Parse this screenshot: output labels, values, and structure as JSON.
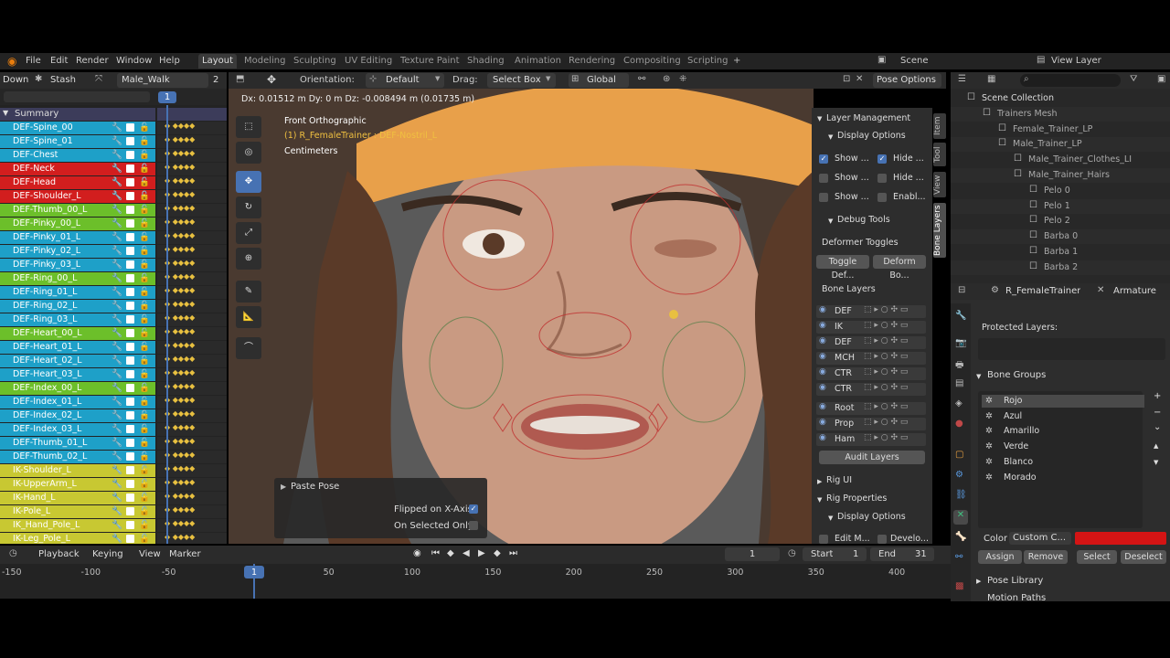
{
  "topbar": {
    "menus": [
      "File",
      "Edit",
      "Render",
      "Window",
      "Help"
    ],
    "workspaces": [
      "Layout",
      "Modeling",
      "Sculpting",
      "UV Editing",
      "Texture Paint",
      "Shading",
      "Animation",
      "Rendering",
      "Compositing",
      "Scripting"
    ],
    "add_tab": "+",
    "scene": "Scene",
    "view_layer": "View Layer"
  },
  "dopesheet": {
    "mode": "Down",
    "stash": "Stash",
    "action": "Male_Walk",
    "users": "2",
    "current_frame": "1",
    "summary": "Summary",
    "channels": [
      {
        "name": "DEF-Spine_00",
        "color": "#1ea0c8"
      },
      {
        "name": "DEF-Spine_01",
        "color": "#1ea0c8"
      },
      {
        "name": "DEF-Chest",
        "color": "#1ea0c8"
      },
      {
        "name": "DEF-Neck",
        "color": "#d21e1e"
      },
      {
        "name": "DEF-Head",
        "color": "#d21e1e"
      },
      {
        "name": "DEF-Shoulder_L",
        "color": "#d21e1e"
      },
      {
        "name": "DEF-Thumb_00_L",
        "color": "#6cbf2a"
      },
      {
        "name": "DEF-Pinky_00_L",
        "color": "#6cbf2a"
      },
      {
        "name": "DEF-Pinky_01_L",
        "color": "#1ea0c8"
      },
      {
        "name": "DEF-Pinky_02_L",
        "color": "#1ea0c8"
      },
      {
        "name": "DEF-Pinky_03_L",
        "color": "#1ea0c8"
      },
      {
        "name": "DEF-Ring_00_L",
        "color": "#6cbf2a"
      },
      {
        "name": "DEF-Ring_01_L",
        "color": "#1ea0c8"
      },
      {
        "name": "DEF-Ring_02_L",
        "color": "#1ea0c8"
      },
      {
        "name": "DEF-Ring_03_L",
        "color": "#1ea0c8"
      },
      {
        "name": "DEF-Heart_00_L",
        "color": "#6cbf2a"
      },
      {
        "name": "DEF-Heart_01_L",
        "color": "#1ea0c8"
      },
      {
        "name": "DEF-Heart_02_L",
        "color": "#1ea0c8"
      },
      {
        "name": "DEF-Heart_03_L",
        "color": "#1ea0c8"
      },
      {
        "name": "DEF-Index_00_L",
        "color": "#6cbf2a"
      },
      {
        "name": "DEF-Index_01_L",
        "color": "#1ea0c8"
      },
      {
        "name": "DEF-Index_02_L",
        "color": "#1ea0c8"
      },
      {
        "name": "DEF-Index_03_L",
        "color": "#1ea0c8"
      },
      {
        "name": "DEF-Thumb_01_L",
        "color": "#1ea0c8"
      },
      {
        "name": "DEF-Thumb_02_L",
        "color": "#1ea0c8"
      },
      {
        "name": "IK-Shoulder_L",
        "color": "#c8c832"
      },
      {
        "name": "IK-UpperArm_L",
        "color": "#c8c832"
      },
      {
        "name": "IK-Hand_L",
        "color": "#c8c832"
      },
      {
        "name": "IK-Pole_L",
        "color": "#c8c832"
      },
      {
        "name": "IK_Hand_Pole_L",
        "color": "#c8c832"
      },
      {
        "name": "IK-Leg_Pole_L",
        "color": "#c8c832"
      }
    ]
  },
  "viewport": {
    "orientation_label": "Orientation:",
    "orientation_value": "Default",
    "drag_label": "Drag:",
    "drag_value": "Select Box",
    "transform_space": "Global",
    "pose_options": "Pose Options",
    "status": "Dx: 0.01512 m   Dy: 0 m   Dz: -0.008494 m (0.01735 m)",
    "view_name": "Front Orthographic",
    "active_bone": "(1) R_FemaleTrainer : DEF-Nostril_L",
    "units": "Centimeters"
  },
  "npanel": {
    "tabs": [
      "Item",
      "Tool",
      "View",
      "Bone Layers"
    ],
    "layer_management": "Layer Management",
    "display_options": "Display Options",
    "show1": "Show ...",
    "hide1": "Hide ...",
    "show2": "Show ...",
    "hide2": "Hide ...",
    "show3": "Show ...",
    "enable": "Enabl...",
    "debug_tools": "Debug Tools",
    "deformer_toggles": "Deformer Toggles",
    "toggle_def": "Toggle Def...",
    "deform_bo": "Deform Bo...",
    "bone_layers": "Bone Layers",
    "layers": [
      "DEF",
      "IK",
      "DEF",
      "MCH",
      "CTR",
      "CTR"
    ],
    "layers2": [
      "Root",
      "Prop",
      "Ham"
    ],
    "audit_layers": "Audit Layers",
    "rig_ui": "Rig UI",
    "rig_properties": "Rig Properties",
    "display_options2": "Display Options",
    "edit_m": "Edit M...",
    "develo": "Develo..."
  },
  "paste_pose": {
    "title": "Paste Pose",
    "flipped_label": "Flipped on X-Axis",
    "on_selected_label": "On Selected Only"
  },
  "outliner": {
    "items": [
      {
        "name": "Scene Collection",
        "indent": 0
      },
      {
        "name": "Trainers Mesh",
        "indent": 1
      },
      {
        "name": "Female_Trainer_LP",
        "indent": 2
      },
      {
        "name": "Male_Trainer_LP",
        "indent": 2
      },
      {
        "name": "Male_Trainer_Clothes_LI",
        "indent": 3
      },
      {
        "name": "Male_Trainer_Hairs",
        "indent": 3
      },
      {
        "name": "Pelo 0",
        "indent": 4
      },
      {
        "name": "Pelo 1",
        "indent": 4
      },
      {
        "name": "Pelo 2",
        "indent": 4
      },
      {
        "name": "Barba 0",
        "indent": 4
      },
      {
        "name": "Barba 1",
        "indent": 4
      },
      {
        "name": "Barba 2",
        "indent": 4
      }
    ]
  },
  "properties": {
    "object": "R_FemaleTrainer",
    "data": "Armature",
    "protected_layers": "Protected Layers:",
    "bone_groups_title": "Bone Groups",
    "bone_groups": [
      "Rojo",
      "Azul",
      "Amarillo",
      "Verde",
      "Blanco",
      "Morado"
    ],
    "color_label": "Color",
    "color_value": "Custom C...",
    "color_swatch": "#d41414",
    "assign": "Assign",
    "remove": "Remove",
    "select": "Select",
    "deselect": "Deselect",
    "pose_library": "Pose Library",
    "motion_paths": "Motion Paths"
  },
  "timeline": {
    "menus": [
      "Playback",
      "Keying",
      "View",
      "Marker"
    ],
    "current": "1",
    "start_label": "Start",
    "start": "1",
    "end_label": "End",
    "end": "31",
    "ticks": [
      "-150",
      "-100",
      "-50",
      "1",
      "50",
      "100",
      "150",
      "200",
      "250",
      "300",
      "350",
      "400"
    ]
  }
}
